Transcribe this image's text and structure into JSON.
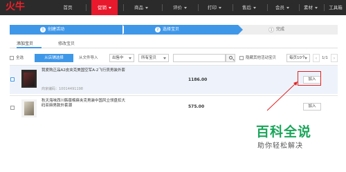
{
  "brand": {
    "logo": "火牛",
    "accent": "#e8192c",
    "primary": "#3f97e8"
  },
  "nav": {
    "items": [
      {
        "label": "首页",
        "has_caret": false
      },
      {
        "label": "促销",
        "has_caret": true,
        "active": true
      },
      {
        "label": "商品",
        "has_caret": true
      },
      {
        "label": "评价",
        "has_caret": true
      },
      {
        "label": "打印",
        "has_caret": true
      },
      {
        "label": "售后",
        "has_caret": true
      },
      {
        "label": "会员",
        "has_caret": true
      },
      {
        "label": "素材",
        "has_caret": true
      },
      {
        "label": "工具箱",
        "has_caret": false
      }
    ]
  },
  "steps": [
    {
      "num": "1",
      "label": "创建活动"
    },
    {
      "num": "2",
      "label": "选择宝贝"
    },
    {
      "num": "3",
      "label": "完成"
    }
  ],
  "tabs": [
    {
      "label": "添加宝贝",
      "active": true
    },
    {
      "label": "修改宝贝",
      "active": false
    }
  ],
  "toolbar": {
    "select_all": "全选",
    "store_select": "从店铺选择",
    "file_import": "从文件导入",
    "status_select": "出售中",
    "category_select": "所有宝贝",
    "search_placeholder": "",
    "hide_other": "隐藏其他活动宝贝",
    "page_size": "每页10个",
    "page_info": "1/1",
    "prev": "‹",
    "next": "›"
  },
  "products": [
    {
      "title": "我爱购正品A2皮夹克美国空军A-2飞行员男装外套",
      "code": "商家编码：10014491198",
      "price": "1186.00",
      "add_label": "加入",
      "highlighted": true
    },
    {
      "title": "秋天海味西川韩版棉麻夹克男装中国风立领盘扣大码亚麻男款外套潮",
      "code": "",
      "price": "575.00",
      "add_label": "加入",
      "highlighted": false
    }
  ],
  "watermark": {
    "line1": "百科全说",
    "line2": "助你轻松解决"
  }
}
